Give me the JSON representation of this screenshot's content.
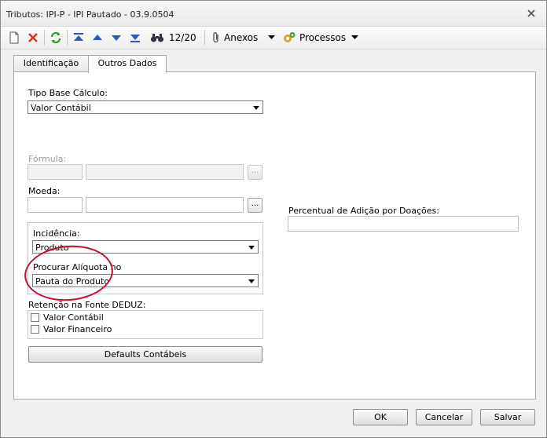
{
  "window": {
    "title": "Tributos: IPI-P - IPI Pautado - 03.9.0504"
  },
  "toolbar": {
    "record_counter": "12/20",
    "anexos_label": "Anexos",
    "processos_label": "Processos"
  },
  "tabs": [
    {
      "label": "Identificação"
    },
    {
      "label": "Outros Dados"
    }
  ],
  "form": {
    "tipo_base_calculo_label": "Tipo Base Cálculo:",
    "tipo_base_calculo_value": "Valor Contábil",
    "formula_label": "Fórmula:",
    "moeda_label": "Moeda:",
    "ellipsis": "...",
    "incidencia_label": "Incidência:",
    "incidencia_value": "Produto",
    "procurar_aliquota_label": "Procurar Alíquota no",
    "procurar_aliquota_value": "Pauta do Produto",
    "retencao_label": "Retenção na Fonte DEDUZ:",
    "retencao_options": [
      "Valor Contábil",
      "Valor Financeiro"
    ],
    "defaults_contabeis_label": "Defaults Contábeis",
    "percentual_label": "Percentual de Adição por Doações:"
  },
  "footer": {
    "ok_label": "OK",
    "cancel_label": "Cancelar",
    "save_label": "Salvar"
  },
  "colors": {
    "highlight_ellipse": "#c8102e",
    "refresh_green": "#2e9a2e",
    "delete_red": "#e03020",
    "nav_blue": "#2a56c6"
  }
}
